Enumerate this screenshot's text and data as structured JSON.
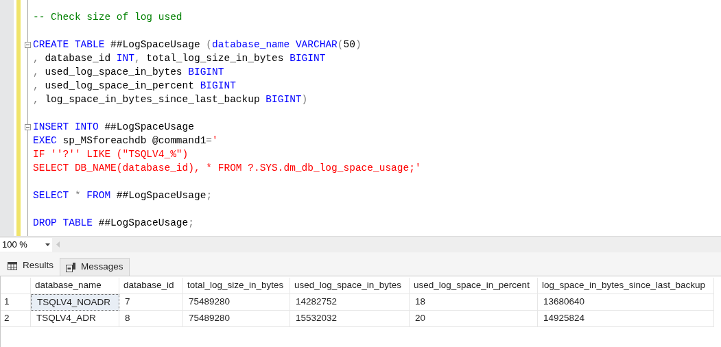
{
  "editor": {
    "lines": [
      {
        "kind": "code",
        "fold": false,
        "tokens": [
          {
            "kind": "comment",
            "t": "-- Check size of log used"
          }
        ]
      },
      {
        "kind": "blank"
      },
      {
        "kind": "code",
        "fold": true,
        "tokens": [
          {
            "kind": "kw",
            "t": "CREATE TABLE"
          },
          {
            "kind": "plain",
            "t": " ##LogSpaceUsage "
          },
          {
            "kind": "op",
            "t": "("
          },
          {
            "kind": "kw",
            "t": "database_name VARCHAR"
          },
          {
            "kind": "op",
            "t": "("
          },
          {
            "kind": "plain",
            "t": "50"
          },
          {
            "kind": "op",
            "t": ")"
          }
        ]
      },
      {
        "kind": "code",
        "fold": false,
        "tokens": [
          {
            "kind": "op",
            "t": ","
          },
          {
            "kind": "plain",
            "t": " database_id "
          },
          {
            "kind": "kw",
            "t": "INT"
          },
          {
            "kind": "op",
            "t": ","
          },
          {
            "kind": "plain",
            "t": " total_log_size_in_bytes "
          },
          {
            "kind": "kw",
            "t": "BIGINT"
          }
        ]
      },
      {
        "kind": "code",
        "fold": false,
        "tokens": [
          {
            "kind": "op",
            "t": ","
          },
          {
            "kind": "plain",
            "t": " used_log_space_in_bytes "
          },
          {
            "kind": "kw",
            "t": "BIGINT"
          }
        ]
      },
      {
        "kind": "code",
        "fold": false,
        "tokens": [
          {
            "kind": "op",
            "t": ","
          },
          {
            "kind": "plain",
            "t": " used_log_space_in_percent "
          },
          {
            "kind": "kw",
            "t": "BIGINT"
          }
        ]
      },
      {
        "kind": "code",
        "fold": false,
        "tokens": [
          {
            "kind": "op",
            "t": ","
          },
          {
            "kind": "plain",
            "t": " log_space_in_bytes_since_last_backup "
          },
          {
            "kind": "kw",
            "t": "BIGINT"
          },
          {
            "kind": "op",
            "t": ")"
          }
        ]
      },
      {
        "kind": "blank"
      },
      {
        "kind": "code",
        "fold": true,
        "tokens": [
          {
            "kind": "kw",
            "t": "INSERT INTO"
          },
          {
            "kind": "plain",
            "t": " ##LogSpaceUsage"
          }
        ]
      },
      {
        "kind": "code",
        "fold": false,
        "tokens": [
          {
            "kind": "kw",
            "t": "EXEC"
          },
          {
            "kind": "plain",
            "t": " sp_MSforeachdb @command1"
          },
          {
            "kind": "op",
            "t": "="
          },
          {
            "kind": "str",
            "t": "'"
          }
        ]
      },
      {
        "kind": "code",
        "fold": false,
        "tokens": [
          {
            "kind": "str",
            "t": "IF ''?'' LIKE (\"TSQLV4_%\")"
          }
        ]
      },
      {
        "kind": "code",
        "fold": false,
        "tokens": [
          {
            "kind": "str",
            "t": "SELECT DB_NAME(database_id), * FROM ?.SYS.dm_db_log_space_usage;'"
          }
        ]
      },
      {
        "kind": "blank"
      },
      {
        "kind": "code",
        "fold": false,
        "tokens": [
          {
            "kind": "kw",
            "t": "SELECT "
          },
          {
            "kind": "op",
            "t": "* "
          },
          {
            "kind": "kw",
            "t": "FROM"
          },
          {
            "kind": "plain",
            "t": " ##LogSpaceUsage"
          },
          {
            "kind": "op",
            "t": ";"
          }
        ]
      },
      {
        "kind": "blank"
      },
      {
        "kind": "code",
        "fold": false,
        "tokens": [
          {
            "kind": "kw",
            "t": "DROP TABLE"
          },
          {
            "kind": "plain",
            "t": " ##LogSpaceUsage"
          },
          {
            "kind": "op",
            "t": ";"
          }
        ]
      }
    ]
  },
  "zoom": {
    "value": "100 %"
  },
  "tabs": [
    {
      "label": "Results",
      "selected": true
    },
    {
      "label": "Messages",
      "selected": false
    }
  ],
  "table": {
    "columns": [
      "database_name",
      "database_id",
      "total_log_size_in_bytes",
      "used_log_space_in_bytes",
      "used_log_space_in_percent",
      "log_space_in_bytes_since_last_backup"
    ],
    "rows": [
      {
        "number": "1",
        "cells": [
          {
            "text": "TSQLV4_NOADR",
            "focused": true
          },
          {
            "text": "7",
            "focused": false
          },
          {
            "text": "75489280",
            "focused": false
          },
          {
            "text": "14282752",
            "focused": false
          },
          {
            "text": "18",
            "focused": false
          },
          {
            "text": "13680640",
            "focused": false
          }
        ]
      },
      {
        "number": "2",
        "cells": [
          {
            "text": "TSQLV4_ADR",
            "focused": false
          },
          {
            "text": "8",
            "focused": false
          },
          {
            "text": "75489280",
            "focused": false
          },
          {
            "text": "15532032",
            "focused": false
          },
          {
            "text": "20",
            "focused": false
          },
          {
            "text": "14925824",
            "focused": false
          }
        ]
      }
    ]
  }
}
